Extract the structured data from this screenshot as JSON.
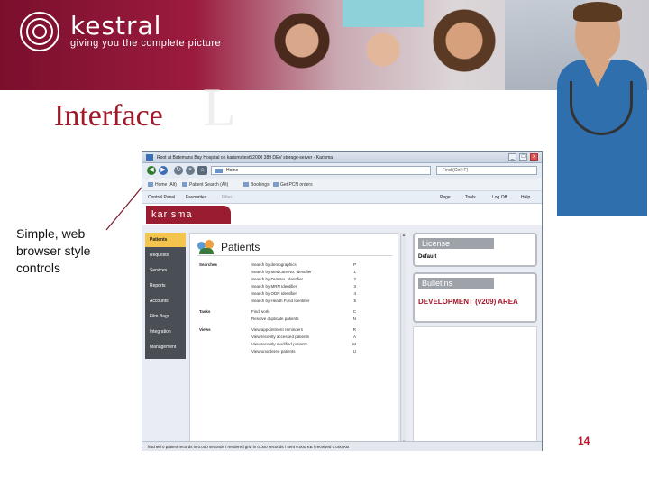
{
  "banner": {
    "brand": "kestral",
    "tagline": "giving you the complete picture"
  },
  "slide": {
    "heading": "Interface",
    "heading_shadow": "L",
    "callout": "Simple, web browser style controls",
    "page_number": "14"
  },
  "window": {
    "title": "Root at Batemans Bay Hospital on karismatest52000 389 DEV storage-server - Karisma",
    "controls": {
      "minimize": "_",
      "maximize": "□",
      "close": "x"
    },
    "address": "Home",
    "search": "Find (Ctrl+F)",
    "favorites": [
      {
        "label": "Home (Alt)"
      },
      {
        "label": "Patient Search (Alt)"
      },
      {
        "label": "Bookings"
      },
      {
        "label": "Get PCN orders"
      }
    ],
    "command_bar": [
      {
        "label": "Control Panel"
      },
      {
        "label": "Favourites"
      },
      {
        "label": "Filter"
      },
      {
        "label": "Page"
      },
      {
        "label": "Tools"
      },
      {
        "label": "Log Off"
      },
      {
        "label": "Help"
      }
    ],
    "app_name": "karisma",
    "nav": [
      {
        "label": "Patients"
      },
      {
        "label": "Requests"
      },
      {
        "label": "Services"
      },
      {
        "label": "Reports"
      },
      {
        "label": "Accounts"
      },
      {
        "label": "Film Bags"
      },
      {
        "label": "Integration"
      },
      {
        "label": "Management"
      }
    ],
    "content": {
      "title": "Patients",
      "sections": [
        {
          "label": "Searches"
        },
        {
          "label": "Tasks"
        },
        {
          "label": "Views"
        }
      ],
      "rows": [
        {
          "text": "Search by demographics",
          "key": "P"
        },
        {
          "text": "Search by Medicare No. Identifier",
          "key": "1"
        },
        {
          "text": "Search by DVA No. Identifier",
          "key": "2"
        },
        {
          "text": "Search by MRN Identifier",
          "key": "3"
        },
        {
          "text": "Search by ODN Identifier",
          "key": "4"
        },
        {
          "text": "Search by Health Fund Identifier",
          "key": "5"
        },
        {
          "text": "Find work",
          "key": "C"
        },
        {
          "text": "Resolve duplicate patients",
          "key": "N"
        },
        {
          "text": "View appointment reminders",
          "key": "R"
        },
        {
          "text": "View recently accessed patients",
          "key": "A"
        },
        {
          "text": "View recently modified patients",
          "key": "M"
        },
        {
          "text": "View unordered patients",
          "key": "U"
        }
      ]
    },
    "license": {
      "header": "License",
      "value": "Default"
    },
    "bulletins": {
      "header": "Bulletins",
      "value": "DEVELOPMENT (v209) AREA"
    },
    "status": "fetched 0 patient records in 0.000 seconds / rendered grid in 0.000 seconds / sent 0.000 KB / received 0.000 KB"
  }
}
